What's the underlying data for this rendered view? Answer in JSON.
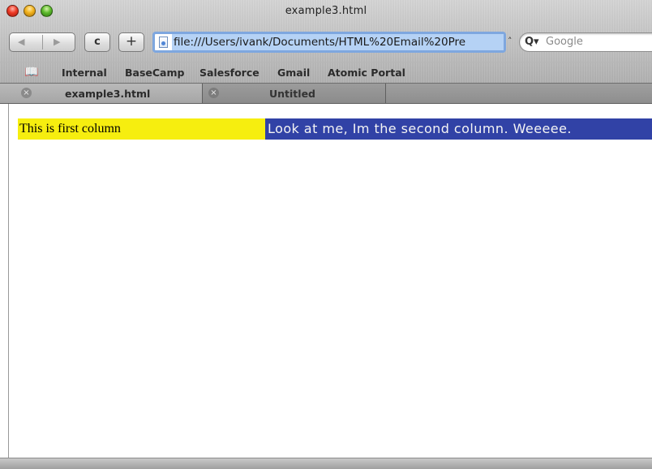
{
  "window": {
    "title": "example3.html"
  },
  "toolbar": {
    "back_icon": "back-arrow-icon",
    "forward_icon": "forward-arrow-icon",
    "reload_glyph": "c",
    "add_glyph": "+",
    "address": "file:///Users/ivank/Documents/HTML%20Email%20Pre",
    "search_placeholder": "Google"
  },
  "bookmarks": [
    {
      "label": "Internal"
    },
    {
      "label": "BaseCamp"
    },
    {
      "label": "Salesforce"
    },
    {
      "label": "Gmail"
    },
    {
      "label": "Atomic Portal"
    }
  ],
  "tabs": [
    {
      "label": "example3.html",
      "active": true
    },
    {
      "label": "Untitled",
      "active": false
    }
  ],
  "page": {
    "first_column": "This is first column",
    "second_column": "Look at me, Im the second column. Weeeee.",
    "first_column_bg": "#f6ee0f",
    "second_column_bg": "#3142a6"
  }
}
